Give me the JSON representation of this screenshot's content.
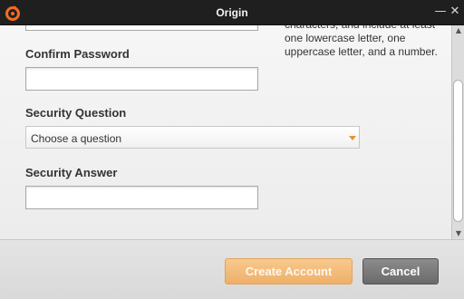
{
  "window": {
    "title": "Origin",
    "minimize_glyph": "—",
    "close_glyph": "✕",
    "accent_color": "#f26c22"
  },
  "form": {
    "hint_text": "characters, and include at least one lowercase letter, one uppercase letter, and a number.",
    "confirm_password": {
      "label": "Confirm Password",
      "value": ""
    },
    "security_question": {
      "label": "Security Question",
      "selected": "Choose a question"
    },
    "security_answer": {
      "label": "Security Answer",
      "value": ""
    }
  },
  "scrollbar": {
    "up_glyph": "▲",
    "down_glyph": "▼"
  },
  "footer": {
    "create_label": "Create Account",
    "cancel_label": "Cancel"
  },
  "icons": {
    "app": "origin-logo-icon",
    "minimize": "minimize-icon",
    "close": "close-icon",
    "dropdown": "chevron-down-icon"
  }
}
